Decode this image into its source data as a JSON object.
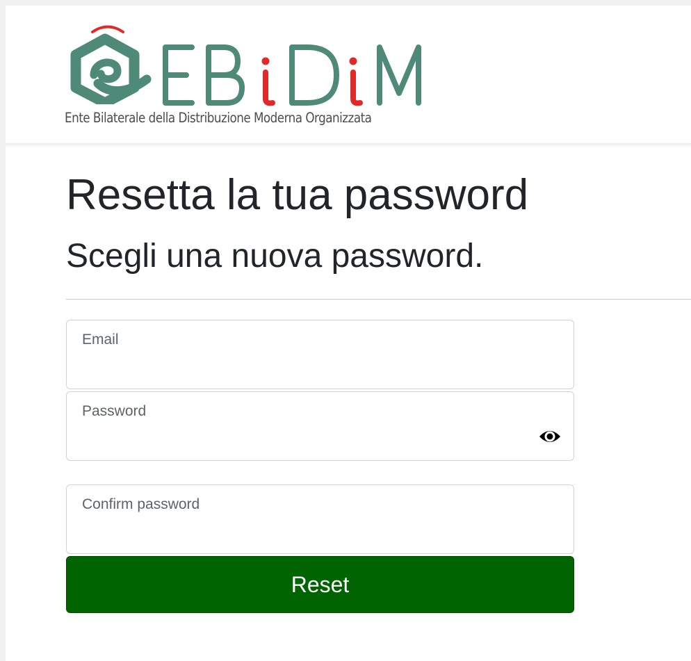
{
  "brand": {
    "logo_letters": [
      "E",
      "B",
      "i",
      "D",
      "i",
      "M"
    ],
    "tagline": "Ente Bilaterale della Distribuzione Moderna Organizzata",
    "colors": {
      "primary": "#4f8a79",
      "accent": "#e02a2a",
      "tagline": "#4d4d4d"
    }
  },
  "page": {
    "title": "Resetta la tua password",
    "subtitle": "Scegli una nuova password."
  },
  "form": {
    "email": {
      "label": "Email",
      "value": ""
    },
    "password": {
      "label": "Password",
      "value": "",
      "toggle_icon": "eye-icon"
    },
    "confirm_password": {
      "label": "Confirm password",
      "value": ""
    },
    "submit_label": "Reset",
    "submit_color": "#006400"
  }
}
